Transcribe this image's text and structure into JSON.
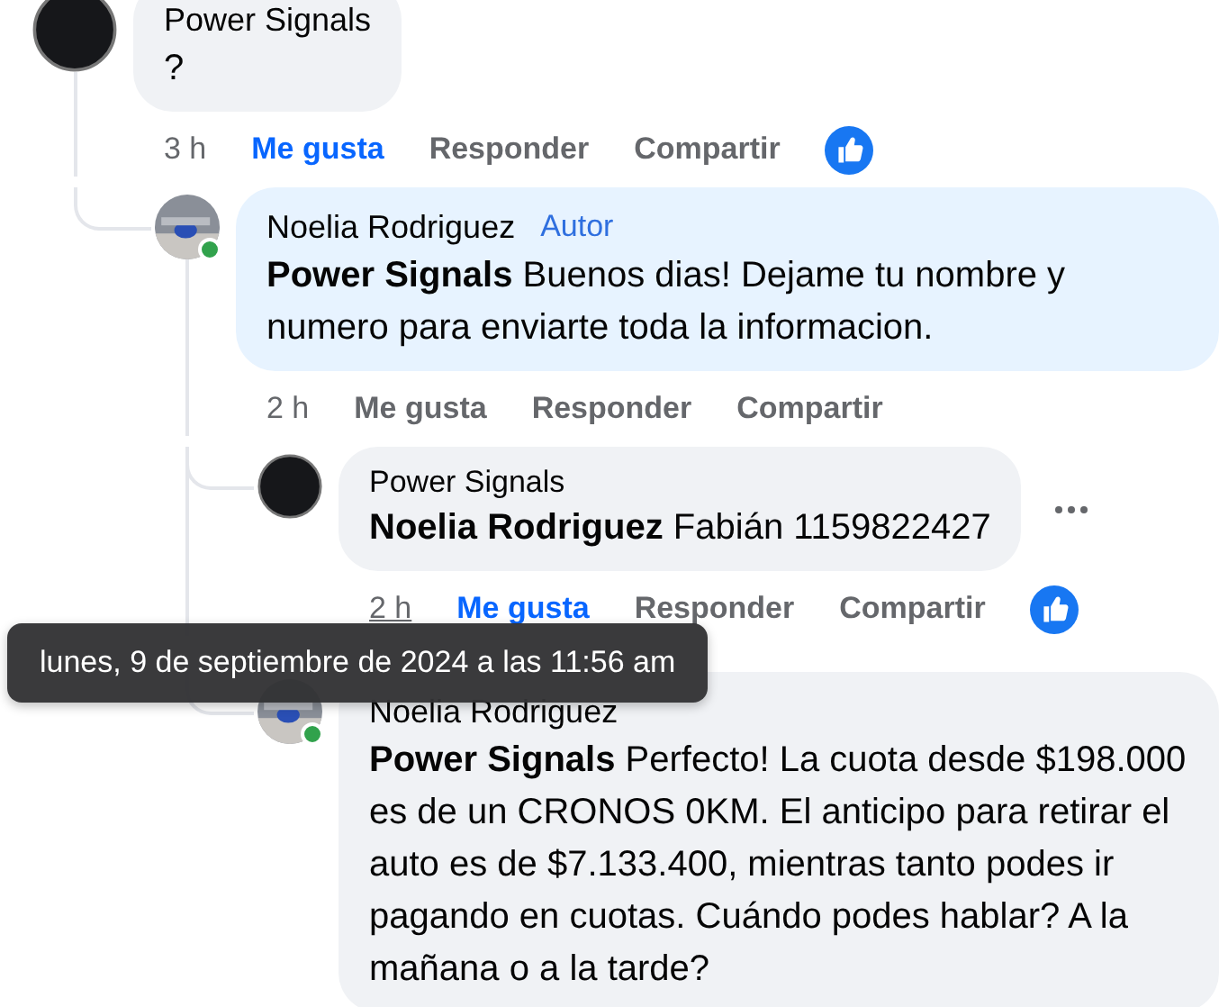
{
  "comments": [
    {
      "author": "Power Signals",
      "kind": "logo_avatar",
      "text": "?",
      "time": "3 h",
      "actions": [
        "Me gusta",
        "Responder",
        "Compartir"
      ],
      "liked": true,
      "reacted": true,
      "children": [
        {
          "author": "Noelia Rodriguez",
          "badge": "Autor",
          "kind": "photo_avatar",
          "online": true,
          "highlighted": true,
          "text": "**Power Signals** Buenos dias! Dejame tu nombre y numero para enviarte toda la informacion.",
          "time": "2 h",
          "actions": [
            "Me gusta",
            "Responder",
            "Compartir"
          ],
          "liked": false,
          "children": [
            {
              "author": "Power Signals",
              "kind": "logo_avatar",
              "small_author": true,
              "text": "**Noelia Rodriguez** Fabián 1159822427",
              "time": "2 h",
              "time_hovered": true,
              "actions": [
                "Me gusta",
                "Responder",
                "Compartir"
              ],
              "liked": true,
              "reacted": true,
              "more_menu": true
            },
            {
              "author": "Noelia Rodriguez",
              "kind": "photo_avatar",
              "online": true,
              "text": "**Power Signals** Perfecto! La cuota desde $198.000 es de un CRONOS 0KM. El anticipo para retirar el auto es de $7.133.400, mientras tanto podes ir pagando en cuotas. Cuándo podes hablar? A la mañana o a la tarde?"
            }
          ]
        }
      ]
    }
  ],
  "tooltip": {
    "text": "lunes, 9 de septiembre de 2024 a las 11:56 am"
  }
}
